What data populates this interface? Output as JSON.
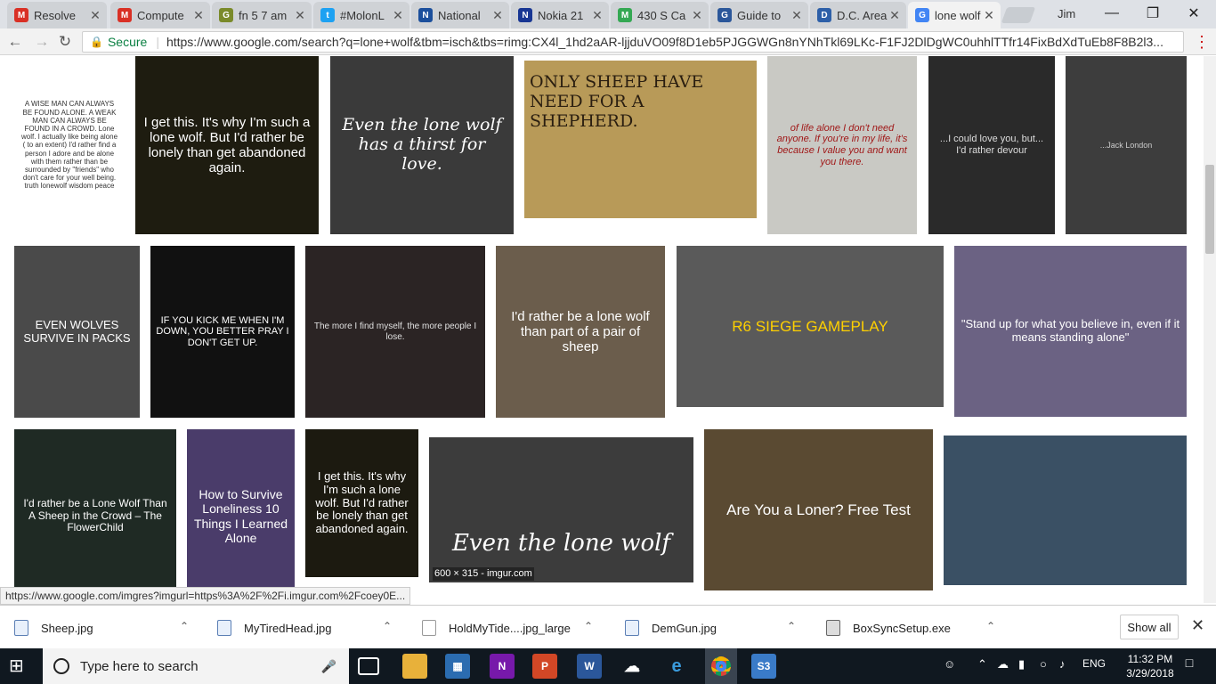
{
  "browser": {
    "tabs": [
      {
        "title": "Resolve",
        "icon": "gmail-icon",
        "color": "#d93025",
        "letter": "M"
      },
      {
        "title": "Compute",
        "icon": "gmail-icon",
        "color": "#d93025",
        "letter": "M"
      },
      {
        "title": "fn 5 7 am",
        "icon": "gun-icon",
        "color": "#7a8a2a",
        "letter": "G"
      },
      {
        "title": "#MolonL",
        "icon": "twitter-icon",
        "color": "#1da1f2",
        "letter": "t"
      },
      {
        "title": "National",
        "icon": "news-icon",
        "color": "#1b4f9c",
        "letter": "N"
      },
      {
        "title": "Nokia 21",
        "icon": "nokia-icon",
        "color": "#183693",
        "letter": "N"
      },
      {
        "title": "430 S Ca",
        "icon": "maps-icon",
        "color": "#34a853",
        "letter": "M"
      },
      {
        "title": "Guide to",
        "icon": "guide-icon",
        "color": "#2b579a",
        "letter": "G"
      },
      {
        "title": "D.C. Area",
        "icon": "dc-icon",
        "color": "#2d5fa8",
        "letter": "D"
      },
      {
        "title": "lone wolf",
        "icon": "google-icon",
        "color": "#4285f4",
        "letter": "G"
      }
    ],
    "user_name": "Jim",
    "secure_label": "Secure",
    "url": "https://www.google.com/search?q=lone+wolf&tbm=isch&tbs=rimg:CX4l_1hd2aAR-ljjduVO09f8D1eb5PJGGWGn8nYNhTkl69LKc-F1FJ2DlDgWC0uhhlTTfr14FixBdXdTuEb8F8B2l3..."
  },
  "results": [
    {
      "caption": "A WISE MAN CAN ALWAYS BE FOUND ALONE. A WEAK MAN CAN ALWAYS BE FOUND IN A CROWD. Lone wolf. I actually like being alone ( to an extent) I'd rather find a person I adore and be alone with them rather than be surrounded by \"friends\" who don't care for your well being. truth lonewolf wisdom peace",
      "bg": "#ffffff",
      "fg": "#333333"
    },
    {
      "caption": "I get this. It's why I'm such a lone wolf. But I'd rather be lonely than get abandoned again.",
      "bg": "#1e1c10",
      "fg": "#ffffff"
    },
    {
      "caption": "Even the lone wolf has a thirst for love.",
      "bg": "#3a3a3a",
      "fg": "#ffffff"
    },
    {
      "caption": "ONLY SHEEP HAVE NEED FOR A SHEPHERD.",
      "bg": "#b89a58",
      "fg": "#2a1e10"
    },
    {
      "caption": "of life alone I don't need anyone. If you're in my life, it's because I value you and want you there.",
      "bg": "#c9c9c4",
      "fg": "#a01818"
    },
    {
      "caption": "...I could love you, but... I'd rather devour",
      "bg": "#2a2a2a",
      "fg": "#dddddd"
    },
    {
      "caption": "...Jack London",
      "bg": "#3d3d3d",
      "fg": "#cccccc"
    },
    {
      "caption": "EVEN WOLVES SURVIVE IN PACKS",
      "bg": "#4a4a4a",
      "fg": "#ffffff"
    },
    {
      "caption": "IF YOU KICK ME WHEN I'M DOWN, YOU BETTER PRAY I DON'T GET UP.",
      "bg": "#111111",
      "fg": "#ffffff"
    },
    {
      "caption": "The more I find myself, the more people I lose.",
      "bg": "#2b2424",
      "fg": "#e0e0e0"
    },
    {
      "caption": "I'd rather be a lone wolf than part of a pair of sheep",
      "bg": "#6b5d4c",
      "fg": "#ffffff"
    },
    {
      "caption": "R6 SIEGE GAMEPLAY",
      "bg": "#5a5a5a",
      "fg": "#ffd000"
    },
    {
      "caption": "\"Stand up for what you believe in, even if it means standing alone\"",
      "bg": "#6b6283",
      "fg": "#ffffff"
    },
    {
      "caption": "I'd rather be a Lone Wolf Than A Sheep in the Crowd – The FlowerChild",
      "bg": "#1f2a24",
      "fg": "#ffffff"
    },
    {
      "caption": "How to Survive Loneliness 10 Things I Learned Alone",
      "bg": "#4a3c6a",
      "fg": "#ffffff"
    },
    {
      "caption": "I get this. It's why I'm such a lone wolf. But I'd rather be lonely than get abandoned again.",
      "bg": "#1c1a10",
      "fg": "#ffffff"
    },
    {
      "caption": "Even the lone wolf",
      "bg": "#3c3c3c",
      "fg": "#ffffff",
      "meta": "600 × 315 - imgur.com"
    },
    {
      "caption": "Are You a Loner? Free Test",
      "bg": "#5a4a32",
      "fg": "#ffffff"
    },
    {
      "caption": "",
      "bg": "#3a5064",
      "fg": "#ffffff"
    }
  ],
  "status_url": "https://www.google.com/imgres?imgurl=https%3A%2F%2Fi.imgur.com%2Fcoey0E...",
  "downloads": [
    "Sheep.jpg",
    "MyTiredHead.jpg",
    "HoldMyTide....jpg_large",
    "DemGun.jpg",
    "BoxSyncSetup.exe"
  ],
  "show_all": "Show all",
  "taskbar": {
    "search_placeholder": "Type here to search",
    "language": "ENG",
    "time": "11:32 PM",
    "date": "3/29/2018"
  }
}
